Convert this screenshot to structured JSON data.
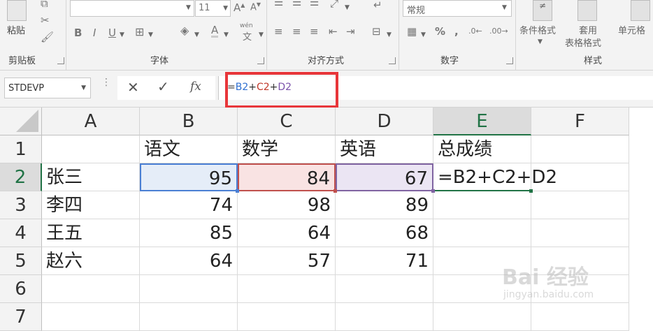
{
  "ribbon": {
    "font_size": "11",
    "number_format": "常规",
    "clipboard": {
      "paste_label": "粘贴",
      "group_label": "剪贴板"
    },
    "font_group_label": "字体",
    "alignment_group_label": "对齐方式",
    "number_group_label": "数字",
    "styles": {
      "conditional_label": "条件格式",
      "table_label_1": "套用",
      "table_label_2": "表格格式",
      "cell_styles_label": "单元格",
      "group_label": "样式"
    },
    "wen_label": "wén",
    "wen_char": "文"
  },
  "formula_bar": {
    "name_box": "STDEVP",
    "fx_label": "fx",
    "formula_parts": [
      {
        "text": "=",
        "color": "#333333"
      },
      {
        "text": "B2",
        "color": "#2f6fd1"
      },
      {
        "text": "+",
        "color": "#333333"
      },
      {
        "text": "C2",
        "color": "#c0392b"
      },
      {
        "text": "+",
        "color": "#333333"
      },
      {
        "text": "D2",
        "color": "#7b52ab"
      }
    ]
  },
  "sheet": {
    "columns": [
      "A",
      "B",
      "C",
      "D",
      "E",
      "F"
    ],
    "rows": [
      "1",
      "2",
      "3",
      "4",
      "5",
      "6",
      "7"
    ],
    "cells": {
      "B1": "语文",
      "C1": "数学",
      "D1": "英语",
      "E1": "总成绩",
      "A2": "张三",
      "B2": "95",
      "C2": "84",
      "D2": "67",
      "E2": "=B2+C2+D2",
      "A3": "李四",
      "B3": "74",
      "C3": "98",
      "D3": "89",
      "A4": "王五",
      "B4": "85",
      "C4": "64",
      "D4": "68",
      "A5": "赵六",
      "B5": "64",
      "C5": "57",
      "D5": "71"
    }
  },
  "watermark": {
    "text": "Bai 经验",
    "url": "jingyan.baidu.com"
  }
}
